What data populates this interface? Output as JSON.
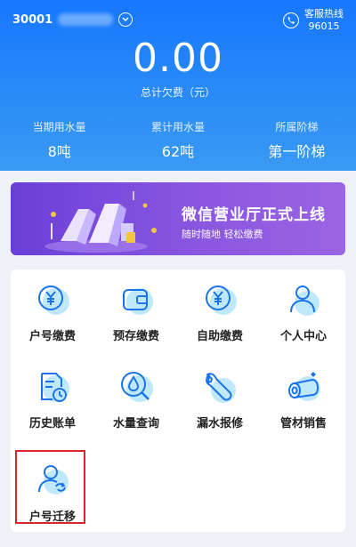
{
  "header": {
    "account_prefix": "30001",
    "hotline_label": "客服热线",
    "hotline_number": "96015",
    "amount": "0.00",
    "amount_label": "总计欠费（元）"
  },
  "stats": [
    {
      "label": "当期用水量",
      "value": "8吨"
    },
    {
      "label": "累计用水量",
      "value": "62吨"
    },
    {
      "label": "所属阶梯",
      "value": "第一阶梯"
    }
  ],
  "banner": {
    "title": "微信营业厅正式上线",
    "subtitle": "随时随地 轻松缴费"
  },
  "menu": [
    {
      "label": "户号缴费",
      "icon": "yen-circle-icon"
    },
    {
      "label": "预存缴费",
      "icon": "wallet-icon"
    },
    {
      "label": "自助缴费",
      "icon": "yen-circle-icon"
    },
    {
      "label": "个人中心",
      "icon": "user-icon"
    },
    {
      "label": "历史账单",
      "icon": "bill-history-icon"
    },
    {
      "label": "水量查询",
      "icon": "water-drop-search-icon"
    },
    {
      "label": "漏水报修",
      "icon": "wrench-icon"
    },
    {
      "label": "管材销售",
      "icon": "pipe-icon"
    },
    {
      "label": "户号迁移",
      "icon": "user-transfer-icon"
    }
  ],
  "colors": {
    "primary": "#1677ff",
    "icon_bg": "#bfe9fb",
    "icon_stroke": "#1a73e8",
    "highlight": "#d9262c"
  }
}
